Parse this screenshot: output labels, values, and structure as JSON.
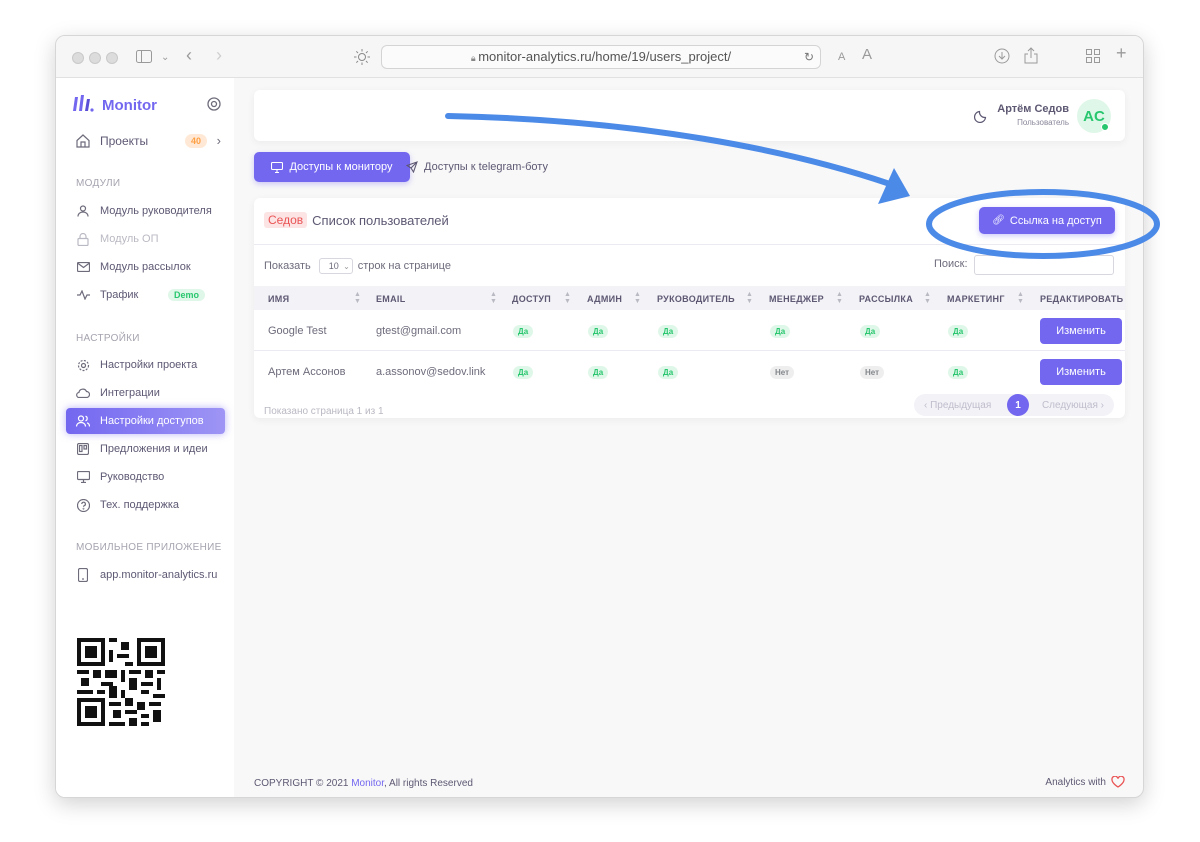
{
  "browser": {
    "url": "monitor-analytics.ru/home/19/users_project/"
  },
  "sidebar": {
    "brand": "Monitor",
    "projects": {
      "label": "Проекты",
      "count": "40"
    },
    "modules_title": "МОДУЛИ",
    "modules": [
      {
        "label": "Модуль руководителя"
      },
      {
        "label": "Модуль ОП"
      },
      {
        "label": "Модуль рассылок"
      },
      {
        "label": "Трафик",
        "badge": "Demo"
      }
    ],
    "settings_title": "НАСТРОЙКИ",
    "settings": [
      {
        "label": "Настройки проекта"
      },
      {
        "label": "Интеграции"
      },
      {
        "label": "Настройки доступов"
      },
      {
        "label": "Предложения и идеи"
      },
      {
        "label": "Руководство"
      },
      {
        "label": "Тех. поддержка"
      }
    ],
    "mobile_title": "МОБИЛЬНОЕ ПРИЛОЖЕНИЕ",
    "mobile_link": "app.monitor-analytics.ru"
  },
  "header": {
    "user_name": "Артём Седов",
    "user_role": "Пользователь",
    "avatar_initials": "AC"
  },
  "tabs": {
    "monitor": "Доступы к монитору",
    "telegram": "Доступы к telegram-боту"
  },
  "card": {
    "tag": "Седов",
    "title": "Список пользователей",
    "access_link_button": "Ссылка на доступ",
    "show_label": "Показать",
    "page_size": "10",
    "rows_label": "строк на странице",
    "search_label": "Поиск:"
  },
  "table": {
    "headers": [
      "ИМЯ",
      "EMAIL",
      "ДОСТУП",
      "АДМИН",
      "РУКОВОДИТЕЛЬ",
      "МЕНЕДЖЕР",
      "РАССЫЛКА",
      "МАРКЕТИНГ",
      "РЕДАКТИРОВАТЬ"
    ],
    "rows": [
      {
        "name": "Google Test",
        "email": "gtest@gmail.com",
        "access": "Да",
        "admin": "Да",
        "head": "Да",
        "manager": "Да",
        "mailing": "Да",
        "marketing": "Да",
        "edit": "Изменить"
      },
      {
        "name": "Артем Ассонов",
        "email": "a.assonov@sedov.link",
        "access": "Да",
        "admin": "Да",
        "head": "Да",
        "manager": "Нет",
        "mailing": "Нет",
        "marketing": "Да",
        "edit": "Изменить"
      }
    ],
    "info": "Показано страница 1 из 1",
    "prev": "‹ Предыдущая",
    "page": "1",
    "next": "Следующая ›"
  },
  "footer": {
    "copyright_prefix": "COPYRIGHT © 2021 ",
    "copyright_link": "Monitor",
    "copyright_suffix": ", All rights Reserved",
    "analytics": "Analytics with"
  },
  "colors": {
    "primary": "#7367f0",
    "success": "#28c76f",
    "annotation": "#4c8ae8"
  }
}
